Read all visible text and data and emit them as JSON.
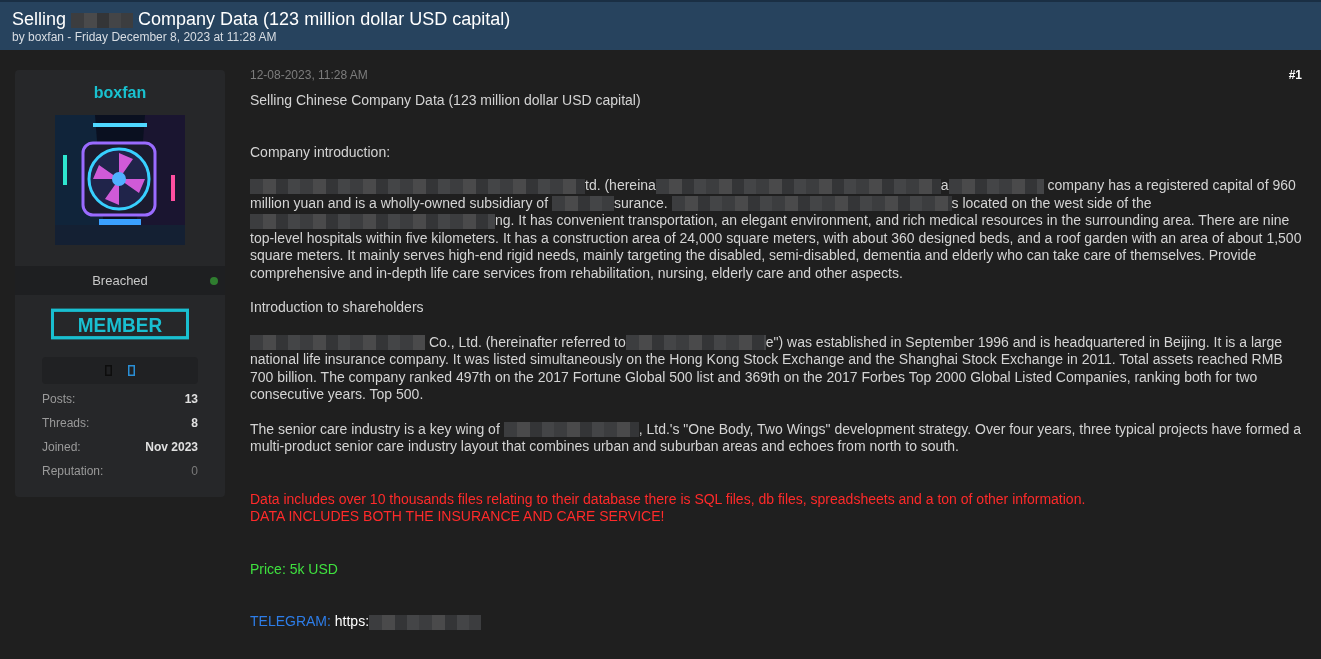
{
  "header": {
    "title": [
      {
        "kind": "text",
        "text": "Selling "
      },
      {
        "kind": "redacted"
      },
      {
        "kind": "text",
        "text": " Company Data (123 million dollar USD capital)"
      }
    ],
    "byline": "by boxfan - Friday December 8, 2023 at 11:28 AM"
  },
  "author": {
    "username": "boxfan",
    "group": "Breached",
    "online": true,
    "rank": "MEMBER",
    "awards": [
      {
        "color": "#0d0d0d"
      },
      {
        "color": "#2a8fd6"
      }
    ],
    "stats": [
      {
        "label": "Posts:",
        "value": "13",
        "kind": "count"
      },
      {
        "label": "Threads:",
        "value": "8",
        "kind": "count"
      },
      {
        "label": "Joined:",
        "value": "Nov 2023",
        "kind": "count"
      },
      {
        "label": "Reputation:",
        "value": "0",
        "kind": "reputation"
      }
    ]
  },
  "post": {
    "date": "12-08-2023, 11:28 AM",
    "number": "#1",
    "blocks": [
      {
        "kind": "plain",
        "segments": [
          {
            "kind": "text",
            "text": "Selling Chinese Company Data (123 million dollar USD capital)"
          }
        ]
      },
      {
        "kind": "plain",
        "segments": [
          {
            "kind": "text",
            "text": "Company introduction:"
          }
        ]
      },
      {
        "kind": "plain",
        "segments": [
          {
            "kind": "redacted"
          },
          {
            "kind": "text",
            "text": "td. (hereina"
          },
          {
            "kind": "redacted"
          },
          {
            "kind": "text",
            "text": "a"
          },
          {
            "kind": "redacted"
          },
          {
            "kind": "text",
            "text": " company has a registered capital of 960 million yuan and is a wholly-owned subsidiary of "
          },
          {
            "kind": "redacted"
          },
          {
            "kind": "text",
            "text": "surance. "
          },
          {
            "kind": "redacted"
          },
          {
            "kind": "text",
            "text": "s located on the west side of the "
          },
          {
            "kind": "redacted"
          },
          {
            "kind": "text",
            "text": "ng. It has convenient transportation, an elegant environment, and rich medical resources in the surrounding area. There are nine top-level hospitals within five kilometers. It has a construction area of 24,000 square meters, with about 360 designed beds, and a roof garden with an area of about 1,500 square meters. It mainly serves high-end rigid needs, mainly targeting the disabled, semi-disabled, dementia and elderly who can take care of themselves. Provide comprehensive and in-depth life care services from rehabilitation, nursing, elderly care and other aspects."
          }
        ]
      },
      {
        "kind": "plain",
        "segments": [
          {
            "kind": "text",
            "text": "Introduction to shareholders"
          }
        ]
      },
      {
        "kind": "plain",
        "segments": [
          {
            "kind": "redacted"
          },
          {
            "kind": "text",
            "text": " Co., Ltd. (hereinafter referred to"
          },
          {
            "kind": "redacted"
          },
          {
            "kind": "text",
            "text": "e\") was established in September 1996 and is headquartered in Beijing. It is a large national life insurance company. It was listed simultaneously on the Hong Kong Stock Exchange and the Shanghai Stock Exchange in 2011. Total assets reached RMB 700 billion. The company ranked 497th on the 2017 Fortune Global 500 list and 369th on the 2017 Forbes Top 2000 Global Listed Companies, ranking both for two consecutive years. Top 500."
          }
        ]
      },
      {
        "kind": "plain",
        "segments": [
          {
            "kind": "text",
            "text": "The senior care industry is a key wing of "
          },
          {
            "kind": "redacted"
          },
          {
            "kind": "text",
            "text": ", Ltd.'s \"One Body, Two Wings\" development strategy. Over four years, three typical projects have formed a multi-product senior care industry layout that combines urban and suburban areas and echoes from north to south."
          }
        ]
      },
      {
        "kind": "alert",
        "segments": [
          {
            "kind": "text",
            "text": "Data includes over 10 thousands files relating to their database there is SQL files, db files, spreadsheets and a ton of other information."
          }
        ]
      },
      {
        "kind": "alert",
        "segments": [
          {
            "kind": "text",
            "text": "DATA INCLUDES BOTH THE INSURANCE AND CARE SERVICE!"
          }
        ]
      },
      {
        "kind": "price",
        "segments": [
          {
            "kind": "text",
            "text": "Price: 5k USD"
          }
        ]
      },
      {
        "kind": "contact",
        "segments": [
          {
            "kind": "label",
            "text": "TELEGRAM:"
          },
          {
            "kind": "text",
            "text": " https:"
          },
          {
            "kind": "redacted"
          }
        ]
      }
    ]
  }
}
